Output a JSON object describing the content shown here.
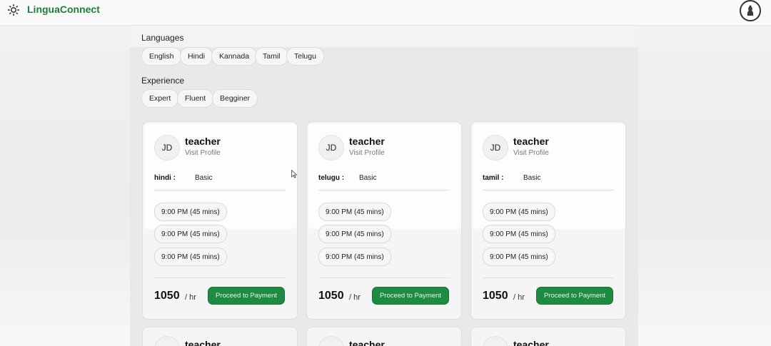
{
  "app": {
    "brand": "LinguaConnect"
  },
  "filters": {
    "languages_label": "Languages",
    "languages": [
      "English",
      "Hindi",
      "Kannada",
      "Tamil",
      "Telugu"
    ],
    "experience_label": "Experience",
    "experience": [
      "Expert",
      "Fluent",
      "Begginer"
    ]
  },
  "cards": [
    {
      "initials": "JD",
      "name": "teacher",
      "visit": "Visit Profile",
      "language": "hindi :",
      "level": "Basic",
      "slots": [
        "9:00 PM (45 mins)",
        "9:00 PM (45 mins)",
        "9:00 PM (45 mins)"
      ],
      "price": "1050",
      "per": "/ hr",
      "cta": "Proceed to Payment"
    },
    {
      "initials": "JD",
      "name": "teacher",
      "visit": "Visit Profile",
      "language": "telugu :",
      "level": "Basic",
      "slots": [
        "9:00 PM (45 mins)",
        "9:00 PM (45 mins)",
        "9:00 PM (45 mins)"
      ],
      "price": "1050",
      "per": "/ hr",
      "cta": "Proceed to Payment"
    },
    {
      "initials": "JD",
      "name": "teacher",
      "visit": "Visit Profile",
      "language": "tamil :",
      "level": "Basic",
      "slots": [
        "9:00 PM (45 mins)",
        "9:00 PM (45 mins)",
        "9:00 PM (45 mins)"
      ],
      "price": "1050",
      "per": "/ hr",
      "cta": "Proceed to Payment"
    }
  ],
  "next_row": [
    {
      "name": "teacher"
    },
    {
      "name": "teacher"
    },
    {
      "name": "teacher"
    }
  ],
  "colors": {
    "brand": "#1e7e34",
    "button": "#1e8b43"
  }
}
